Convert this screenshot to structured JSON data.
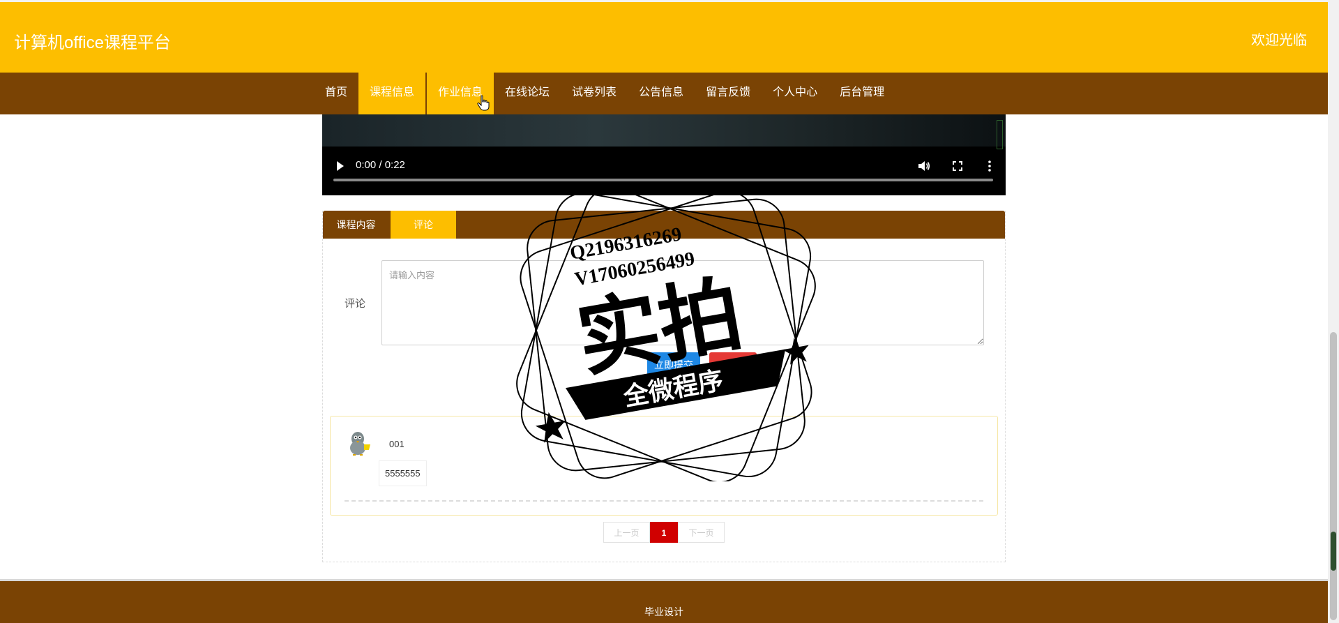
{
  "header": {
    "title": "计算机office课程平台",
    "welcome": "欢迎光临"
  },
  "nav": {
    "items": [
      {
        "label": "首页"
      },
      {
        "label": "课程信息"
      },
      {
        "label": "作业信息"
      },
      {
        "label": "在线论坛"
      },
      {
        "label": "试卷列表"
      },
      {
        "label": "公告信息"
      },
      {
        "label": "留言反馈"
      },
      {
        "label": "个人中心"
      },
      {
        "label": "后台管理"
      }
    ],
    "active": "课程信息"
  },
  "video": {
    "time": "0:00 / 0:22",
    "progress": 0
  },
  "tabs": {
    "content_label": "课程内容",
    "comment_label": "评论",
    "active": "评论"
  },
  "comment_form": {
    "label": "评论",
    "placeholder": "请输入内容",
    "submit_label": "立即提交",
    "reset_label": "重置"
  },
  "comments": [
    {
      "user": "001",
      "text": "5555555",
      "avatar": "cartoon-avatar"
    }
  ],
  "pagination": {
    "prev": "上一页",
    "current": "1",
    "next": "下一页"
  },
  "footer": {
    "text": "毕业设计"
  },
  "watermark": {
    "line1": "Q2196316269",
    "line2": "V17060256499",
    "main": "实拍",
    "ribbon": "全微程序"
  },
  "colors": {
    "header": "#FDBE00",
    "nav": "#7A4304",
    "active_tab": "#FDBE00",
    "submit": "#1E88E5",
    "reset": "#E53935",
    "page_active": "#D00000"
  }
}
